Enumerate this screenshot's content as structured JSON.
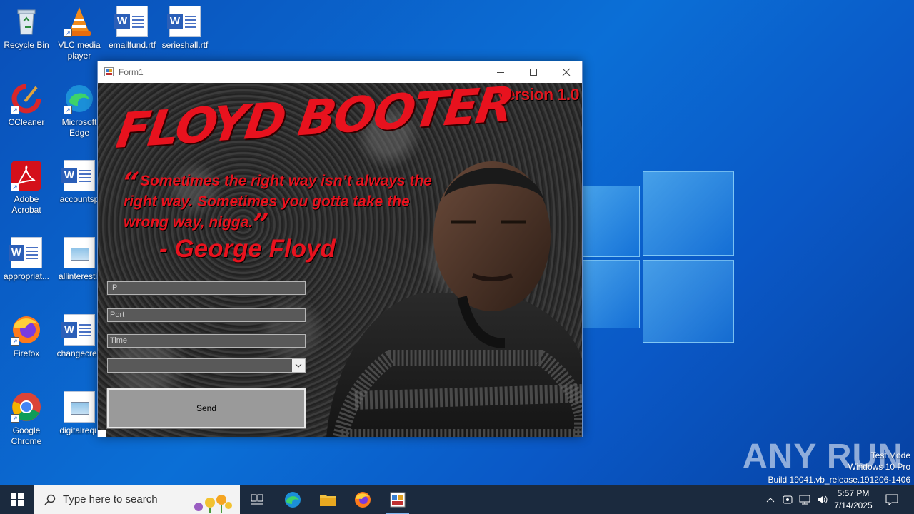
{
  "desktop": {
    "icons": [
      {
        "label": "Recycle Bin",
        "icon": "recycle-bin-icon"
      },
      {
        "label": "VLC media player",
        "icon": "vlc-icon"
      },
      {
        "label": "emailfund.rtf",
        "icon": "word-document-icon"
      },
      {
        "label": "serieshall.rtf",
        "icon": "word-document-icon"
      },
      {
        "label": "CCleaner",
        "icon": "ccleaner-icon"
      },
      {
        "label": "Microsoft Edge",
        "icon": "edge-icon"
      },
      {
        "label": "Adobe Acrobat",
        "icon": "acrobat-icon"
      },
      {
        "label": "accountsp",
        "icon": "word-document-icon"
      },
      {
        "label": "appropriat...",
        "icon": "word-document-icon"
      },
      {
        "label": "allinterestir",
        "icon": "image-file-icon"
      },
      {
        "label": "Firefox",
        "icon": "firefox-icon"
      },
      {
        "label": "changecrea",
        "icon": "word-document-icon"
      },
      {
        "label": "Google Chrome",
        "icon": "chrome-icon"
      },
      {
        "label": "digitalrequ",
        "icon": "image-file-icon"
      }
    ]
  },
  "window": {
    "title": "Form1",
    "version": "Version 1.0",
    "logo": "FLOYD BOOTER",
    "quote_open": "“",
    "quote_text": "Sometimes the right way isn’t always the right way. Sometimes you gotta take the wrong way, nigga.",
    "quote_close": "”",
    "author": "- George Floyd",
    "fields": {
      "ip_placeholder": "IP",
      "port_placeholder": "Port",
      "time_placeholder": "Time"
    },
    "method_select_value": "",
    "send_label": "Send"
  },
  "watermark": {
    "brand": "ANY RUN",
    "line1": "Test Mode",
    "line2": "Windows 10 Pro",
    "line3": "Build 19041.vb_release.191206-1406"
  },
  "taskbar": {
    "search_placeholder": "Type here to search",
    "time": "5:57 PM",
    "date": "7/14/2025"
  },
  "colors": {
    "accent_red": "#e8121e",
    "taskbar": "#1b2a3e",
    "desktop": "#0b6fd6"
  }
}
